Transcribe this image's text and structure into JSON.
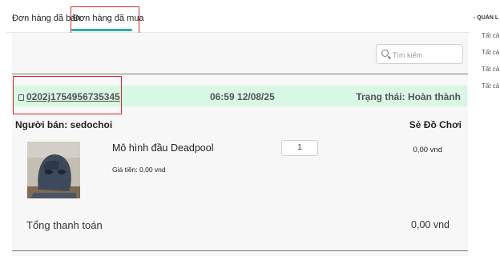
{
  "tabs": {
    "sold": "Đơn hàng đã bán",
    "bought": "Đơn hàng đã mua"
  },
  "search": {
    "placeholder": "Tìm kiếm"
  },
  "order": {
    "code": "0202j1754956735345",
    "time": "06:59 12/08/25",
    "status": "Trạng thái: Hoàn thành",
    "seller": "Người bán: sedochoi",
    "shop": "Sẻ Đồ Chơi",
    "item": {
      "name": "Mô hình đầu Deadpool",
      "price": "Giá tiền:  0,00 vnd",
      "quantity": "1",
      "total": "0,00 vnd"
    },
    "grand_total_label": "Tổng thanh toán",
    "grand_total_value": "0,00 vnd"
  },
  "sidebar": {
    "heading": "- QUẢN L",
    "items": [
      "Tất cả",
      "Tất cả",
      "Tất cả",
      "Tất cả"
    ]
  },
  "colors": {
    "accent": "#2ab3a3",
    "highlight": "#d9262c",
    "status_bar": "#d8f7e4"
  }
}
